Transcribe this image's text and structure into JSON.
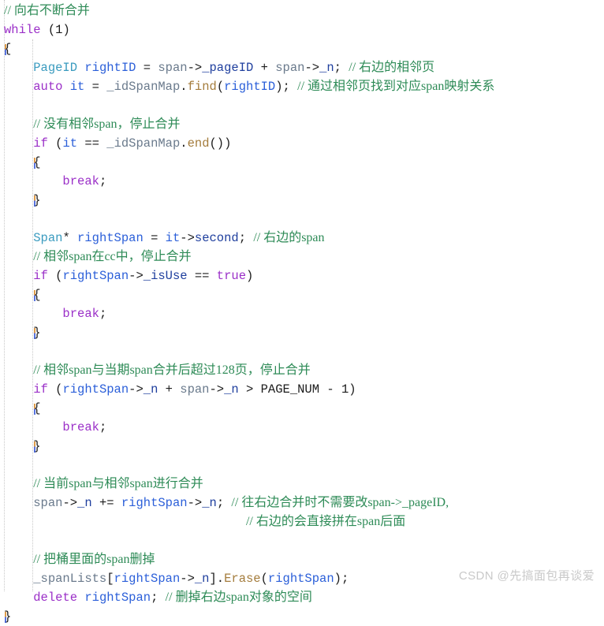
{
  "editor": {
    "language": "C++",
    "theme": "visual-studio-light",
    "background_color": "#ffffff",
    "colors": {
      "comment": "#2e8b57",
      "keyword": "#9b30c8",
      "type": "#3a9bbf",
      "method": "#a47c3c",
      "variable": "#2b5fd9",
      "member": "#1f3f9e",
      "identifier": "#6a7a8c",
      "plain": "#1c1c1c",
      "indent_guide": "#c8c8c8",
      "watermark": "#c9c9c9"
    }
  },
  "watermark": {
    "text": "CSDN @先搞面包再谈爱"
  },
  "code": {
    "lines": [
      {
        "indent": 0,
        "tokens": [
          {
            "t": "// 向右不断合并",
            "c": "cmt-cn"
          }
        ]
      },
      {
        "indent": 0,
        "tokens": [
          {
            "t": "while",
            "c": "kw"
          },
          {
            "t": " (",
            "c": "punct"
          },
          {
            "t": "1",
            "c": "num"
          },
          {
            "t": ")",
            "c": "punct"
          }
        ]
      },
      {
        "indent": 0,
        "tokens": [
          {
            "t": "{",
            "c": "brace"
          }
        ]
      },
      {
        "indent": 1,
        "tokens": [
          {
            "t": "PageID",
            "c": "type"
          },
          {
            "t": " ",
            "c": "punct"
          },
          {
            "t": "rightID",
            "c": "var"
          },
          {
            "t": " = ",
            "c": "punct"
          },
          {
            "t": "span",
            "c": "ident"
          },
          {
            "t": "->",
            "c": "punct"
          },
          {
            "t": "_pageID",
            "c": "member"
          },
          {
            "t": " + ",
            "c": "punct"
          },
          {
            "t": "span",
            "c": "ident"
          },
          {
            "t": "->",
            "c": "punct"
          },
          {
            "t": "_n",
            "c": "member"
          },
          {
            "t": "; ",
            "c": "punct"
          },
          {
            "t": "// 右边的相邻页",
            "c": "cmt-cn"
          }
        ]
      },
      {
        "indent": 1,
        "tokens": [
          {
            "t": "auto",
            "c": "kw"
          },
          {
            "t": " ",
            "c": "punct"
          },
          {
            "t": "it",
            "c": "var"
          },
          {
            "t": " = ",
            "c": "punct"
          },
          {
            "t": "_idSpanMap",
            "c": "ident"
          },
          {
            "t": ".",
            "c": "punct"
          },
          {
            "t": "find",
            "c": "method"
          },
          {
            "t": "(",
            "c": "punct"
          },
          {
            "t": "rightID",
            "c": "var"
          },
          {
            "t": "); ",
            "c": "punct"
          },
          {
            "t": "// 通过相邻页找到对应span映射关系",
            "c": "cmt-cn"
          }
        ]
      },
      {
        "indent": 1,
        "tokens": []
      },
      {
        "indent": 1,
        "tokens": [
          {
            "t": "// 没有相邻span，停止合并",
            "c": "cmt-cn"
          }
        ]
      },
      {
        "indent": 1,
        "tokens": [
          {
            "t": "if",
            "c": "kw"
          },
          {
            "t": " (",
            "c": "punct"
          },
          {
            "t": "it",
            "c": "var"
          },
          {
            "t": " == ",
            "c": "punct"
          },
          {
            "t": "_idSpanMap",
            "c": "ident"
          },
          {
            "t": ".",
            "c": "punct"
          },
          {
            "t": "end",
            "c": "method"
          },
          {
            "t": "())",
            "c": "punct"
          }
        ]
      },
      {
        "indent": 1,
        "tokens": [
          {
            "t": "{",
            "c": "brace"
          }
        ]
      },
      {
        "indent": 2,
        "tokens": [
          {
            "t": "break",
            "c": "kw"
          },
          {
            "t": ";",
            "c": "punct"
          }
        ]
      },
      {
        "indent": 1,
        "tokens": [
          {
            "t": "}",
            "c": "brace"
          }
        ]
      },
      {
        "indent": 1,
        "tokens": []
      },
      {
        "indent": 1,
        "tokens": [
          {
            "t": "Span",
            "c": "type"
          },
          {
            "t": "* ",
            "c": "punct"
          },
          {
            "t": "rightSpan",
            "c": "var"
          },
          {
            "t": " = ",
            "c": "punct"
          },
          {
            "t": "it",
            "c": "var"
          },
          {
            "t": "->",
            "c": "punct"
          },
          {
            "t": "second",
            "c": "member"
          },
          {
            "t": "; ",
            "c": "punct"
          },
          {
            "t": "// 右边的span",
            "c": "cmt-cn"
          }
        ]
      },
      {
        "indent": 1,
        "tokens": [
          {
            "t": "// 相邻span在cc中，停止合并",
            "c": "cmt-cn"
          }
        ]
      },
      {
        "indent": 1,
        "tokens": [
          {
            "t": "if",
            "c": "kw"
          },
          {
            "t": " (",
            "c": "punct"
          },
          {
            "t": "rightSpan",
            "c": "var"
          },
          {
            "t": "->",
            "c": "punct"
          },
          {
            "t": "_isUse",
            "c": "member"
          },
          {
            "t": " == ",
            "c": "punct"
          },
          {
            "t": "true",
            "c": "kw"
          },
          {
            "t": ")",
            "c": "punct"
          }
        ]
      },
      {
        "indent": 1,
        "tokens": [
          {
            "t": "{",
            "c": "brace"
          }
        ]
      },
      {
        "indent": 2,
        "tokens": [
          {
            "t": "break",
            "c": "kw"
          },
          {
            "t": ";",
            "c": "punct"
          }
        ]
      },
      {
        "indent": 1,
        "tokens": [
          {
            "t": "}",
            "c": "brace"
          }
        ]
      },
      {
        "indent": 1,
        "tokens": []
      },
      {
        "indent": 1,
        "tokens": [
          {
            "t": "// 相邻span与当期span合并后超过128页，停止合并",
            "c": "cmt-cn"
          }
        ]
      },
      {
        "indent": 1,
        "tokens": [
          {
            "t": "if",
            "c": "kw"
          },
          {
            "t": " (",
            "c": "punct"
          },
          {
            "t": "rightSpan",
            "c": "var"
          },
          {
            "t": "->",
            "c": "punct"
          },
          {
            "t": "_n",
            "c": "member"
          },
          {
            "t": " + ",
            "c": "punct"
          },
          {
            "t": "span",
            "c": "ident"
          },
          {
            "t": "->",
            "c": "punct"
          },
          {
            "t": "_n",
            "c": "member"
          },
          {
            "t": " > ",
            "c": "punct"
          },
          {
            "t": "PAGE_NUM",
            "c": "macro"
          },
          {
            "t": " - ",
            "c": "punct"
          },
          {
            "t": "1",
            "c": "num"
          },
          {
            "t": ")",
            "c": "punct"
          }
        ]
      },
      {
        "indent": 1,
        "tokens": [
          {
            "t": "{",
            "c": "brace"
          }
        ]
      },
      {
        "indent": 2,
        "tokens": [
          {
            "t": "break",
            "c": "kw"
          },
          {
            "t": ";",
            "c": "punct"
          }
        ]
      },
      {
        "indent": 1,
        "tokens": [
          {
            "t": "}",
            "c": "brace"
          }
        ]
      },
      {
        "indent": 1,
        "tokens": []
      },
      {
        "indent": 1,
        "tokens": [
          {
            "t": "// 当前span与相邻span进行合并",
            "c": "cmt-cn"
          }
        ]
      },
      {
        "indent": 1,
        "tokens": [
          {
            "t": "span",
            "c": "ident"
          },
          {
            "t": "->",
            "c": "punct"
          },
          {
            "t": "_n",
            "c": "member"
          },
          {
            "t": " += ",
            "c": "punct"
          },
          {
            "t": "rightSpan",
            "c": "var"
          },
          {
            "t": "->",
            "c": "punct"
          },
          {
            "t": "_n",
            "c": "member"
          },
          {
            "t": "; ",
            "c": "punct"
          },
          {
            "t": "// 往右边合并时不需要改span->_pageID,",
            "c": "cmt-cn"
          }
        ]
      },
      {
        "indent": 1,
        "tokens": [
          {
            "t": "                             ",
            "c": "punct"
          },
          {
            "t": "// 右边的会直接拼在span后面",
            "c": "cmt-cn"
          }
        ]
      },
      {
        "indent": 1,
        "tokens": []
      },
      {
        "indent": 1,
        "tokens": [
          {
            "t": "// 把桶里面的span删掉",
            "c": "cmt-cn"
          }
        ]
      },
      {
        "indent": 1,
        "tokens": [
          {
            "t": "_spanLists",
            "c": "ident"
          },
          {
            "t": "[",
            "c": "punct"
          },
          {
            "t": "rightSpan",
            "c": "var"
          },
          {
            "t": "->",
            "c": "punct"
          },
          {
            "t": "_n",
            "c": "member"
          },
          {
            "t": "].",
            "c": "punct"
          },
          {
            "t": "Erase",
            "c": "method"
          },
          {
            "t": "(",
            "c": "punct"
          },
          {
            "t": "rightSpan",
            "c": "var"
          },
          {
            "t": ");",
            "c": "punct"
          }
        ]
      },
      {
        "indent": 1,
        "tokens": [
          {
            "t": "delete",
            "c": "kw"
          },
          {
            "t": " ",
            "c": "punct"
          },
          {
            "t": "rightSpan",
            "c": "var"
          },
          {
            "t": "; ",
            "c": "punct"
          },
          {
            "t": "// 删掉右边span对象的空间",
            "c": "cmt-cn"
          }
        ]
      },
      {
        "indent": 0,
        "tokens": [
          {
            "t": "}",
            "c": "brace"
          }
        ]
      }
    ]
  }
}
